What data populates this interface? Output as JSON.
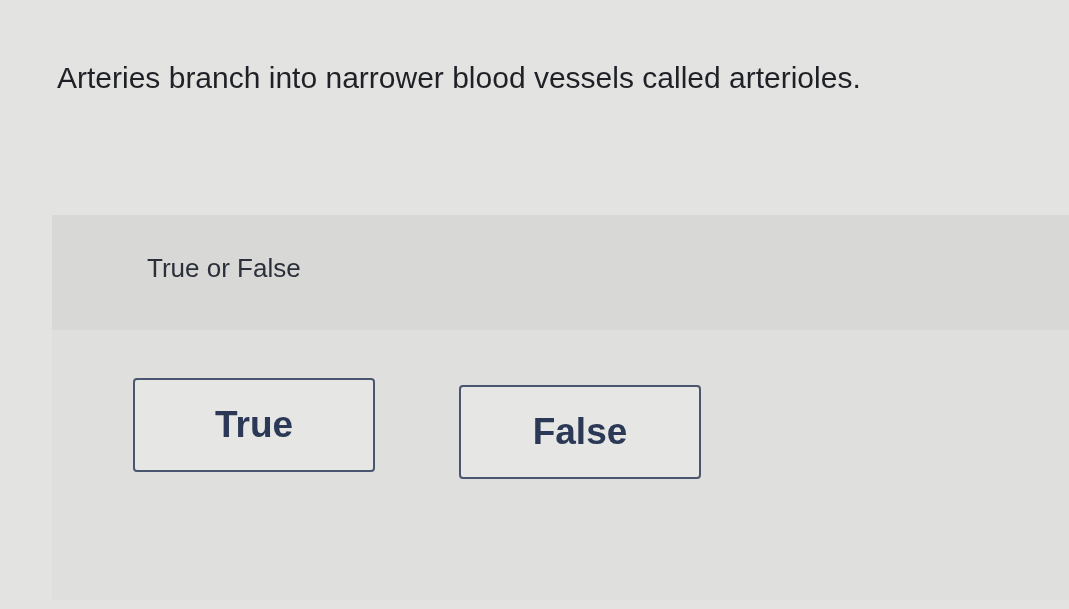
{
  "question": {
    "text": "Arteries branch into narrower blood vessels called arterioles."
  },
  "answer_panel": {
    "prompt": "True or False",
    "options": [
      {
        "label": "True",
        "selected": false
      },
      {
        "label": "False",
        "selected": false
      }
    ]
  }
}
